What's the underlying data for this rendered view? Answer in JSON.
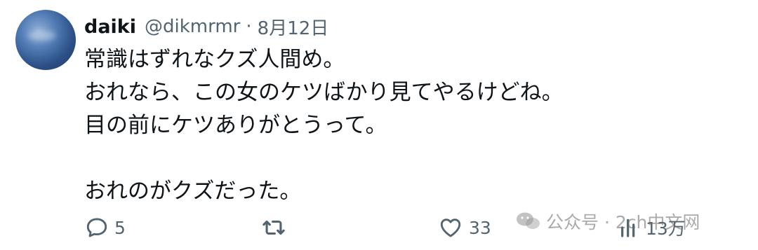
{
  "tweet": {
    "display_name": "daiki",
    "handle": "@dikmrmr",
    "separator": "·",
    "date": "8月12日",
    "lines": [
      "常識はずれなクズ人間め。",
      "おれなら、この女のケツばかり見てやるけどね。",
      "目の前にケツありがとうって。",
      "",
      "おれのがクズだった。"
    ]
  },
  "actions": {
    "reply": {
      "icon": "reply-icon",
      "count": "5"
    },
    "retweet": {
      "icon": "retweet-icon",
      "count": ""
    },
    "like": {
      "icon": "heart-icon",
      "count": "33"
    },
    "views": {
      "icon": "views-icon",
      "count": "13万"
    }
  },
  "watermark": {
    "text": "公众号 · 2ch中文网"
  },
  "colors": {
    "text": "#0f1419",
    "secondary": "#536471",
    "background": "#ffffff"
  }
}
